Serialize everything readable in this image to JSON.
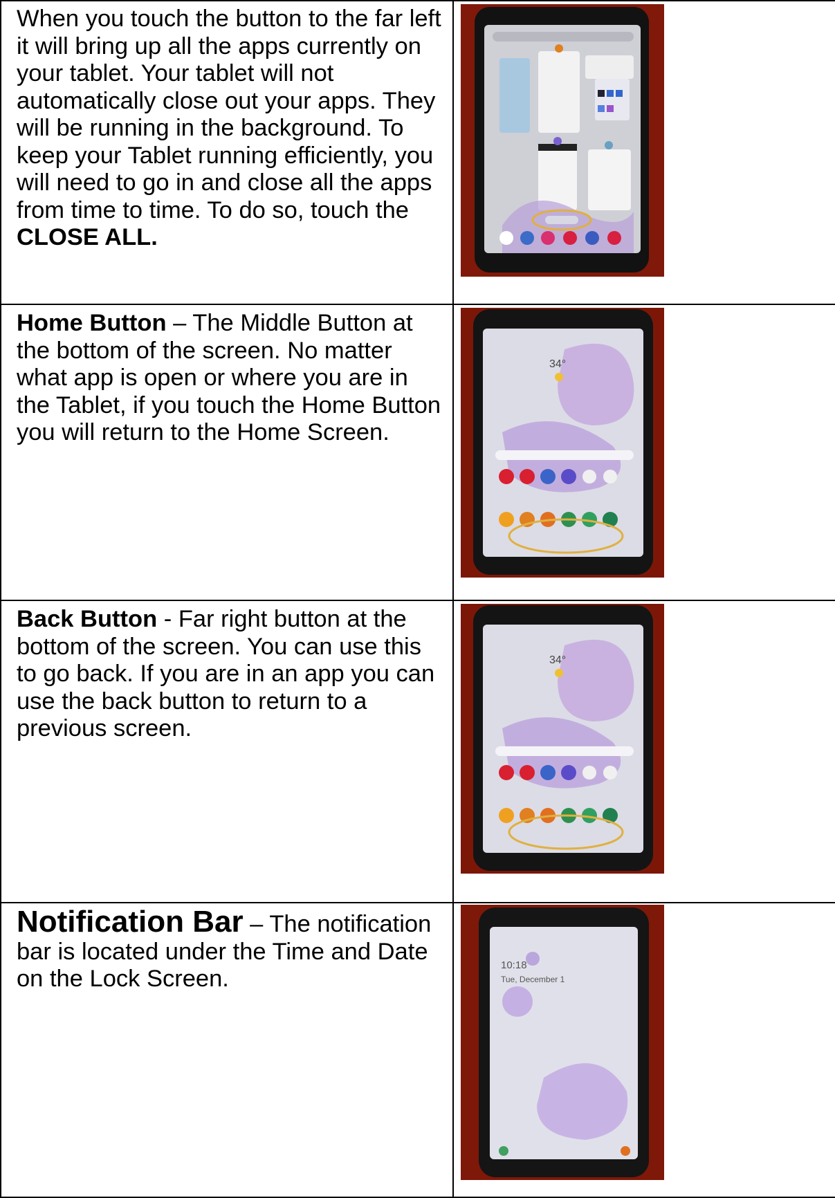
{
  "rows": [
    {
      "lead": "",
      "text": "When you touch the button to the far left it will bring up all the apps currently on your tablet. Your tablet will not automatically close out your apps. They will be running in the background. To keep your Tablet running efficiently, you will need to go in and close all the apps from time to time. To do so, touch the",
      "emphasis": "CLOSE ALL.",
      "photo": {
        "subject": "recent-apps-screen",
        "button_label": "Close all"
      }
    },
    {
      "lead": "Home Button",
      "text": " – The Middle Button at the bottom of the screen. No matter what app is open or where you are in the Tablet, if you touch the Home Button you will return to the Home Screen.",
      "photo": {
        "subject": "home-screen",
        "temperature": "34°"
      }
    },
    {
      "lead": "Back Button",
      "text": " - Far right button at the bottom of the screen. You can use this to go back. If you are in an app you can use the back button to return to a previous screen.",
      "photo": {
        "subject": "home-screen",
        "temperature": "34°"
      }
    },
    {
      "lead": "Notification Bar",
      "text": " – The notification bar is located under the Time and Date on the Lock Screen.",
      "photo": {
        "subject": "lock-screen",
        "time": "10:18",
        "date": "Tue, December 1"
      }
    }
  ],
  "colors": {
    "border": "#000000",
    "background_red": "#7a1608",
    "case_black": "#141414",
    "highlight_circle": "#e0b040"
  }
}
